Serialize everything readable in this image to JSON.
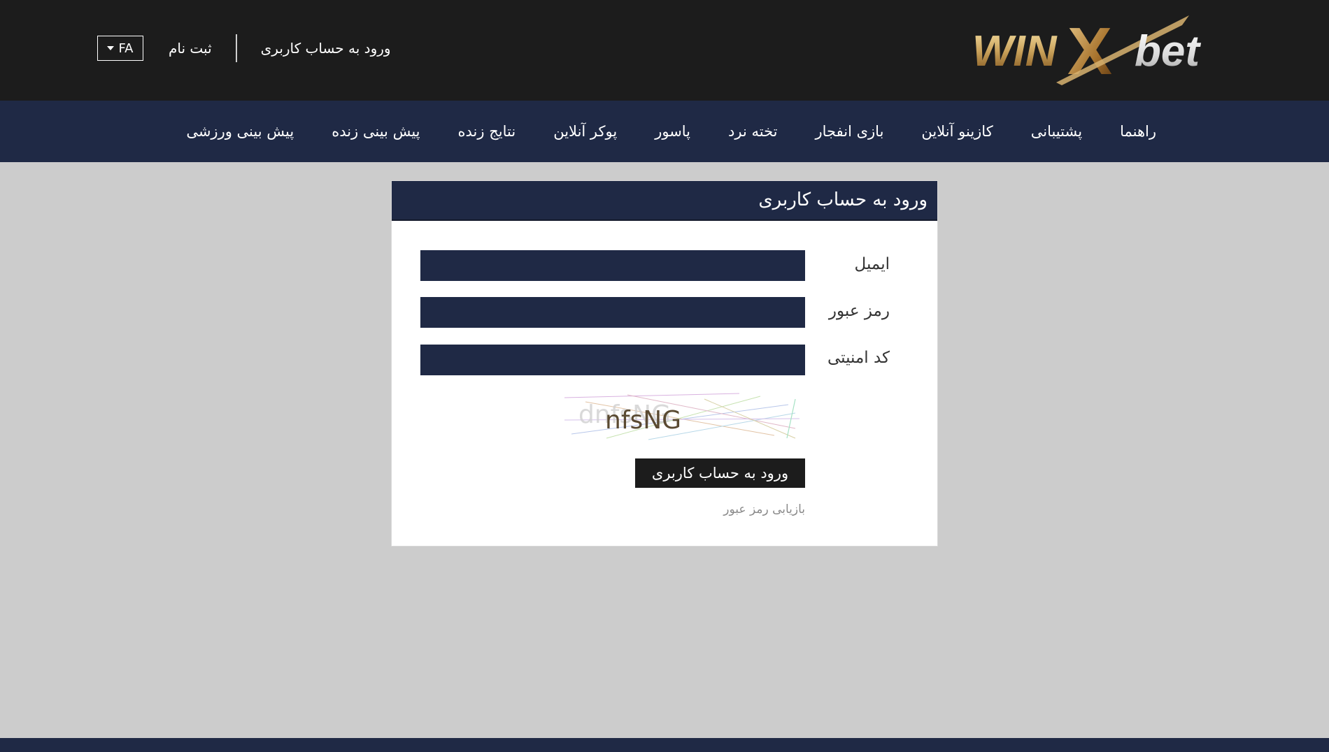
{
  "brand": {
    "logo_text_win": "WIN",
    "logo_text_x": "X",
    "logo_text_bet": "bet",
    "colors": {
      "gold": "#c9a15a",
      "dark_gold": "#8a5a1e",
      "silver": "#e8e8e8",
      "topbar_bg": "#1c1c1c",
      "navy": "#1f2945",
      "page_bg": "#cccccc"
    }
  },
  "topbar": {
    "language": "FA",
    "register_label": "ثبت نام",
    "login_label": "ورود به حساب کاربری"
  },
  "nav": {
    "items": [
      {
        "label": "پیش بینی ورزشی"
      },
      {
        "label": "پیش بینی زنده"
      },
      {
        "label": "نتایج زنده"
      },
      {
        "label": "پوکر آنلاین"
      },
      {
        "label": "پاسور"
      },
      {
        "label": "تخته نرد"
      },
      {
        "label": "بازی انفجار"
      },
      {
        "label": "کازینو آنلاین"
      },
      {
        "label": "پشتیبانی"
      },
      {
        "label": "راهنما"
      }
    ]
  },
  "login_form": {
    "title": "ورود به حساب کاربری",
    "email_label": "ایمیل",
    "email_value": "",
    "password_label": "رمز عبور",
    "password_value": "",
    "security_code_label": "کد امنیتی",
    "security_code_value": "",
    "captcha_text": "nfsNG",
    "submit_label": "ورود به حساب کاربری",
    "forgot_password_label": "بازیابی رمز عبور"
  }
}
